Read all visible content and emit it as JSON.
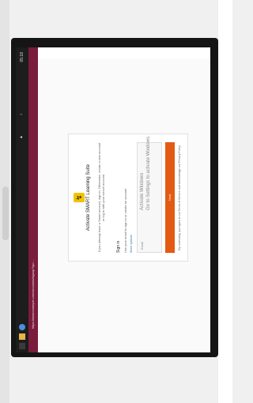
{
  "device": {
    "taskbar": {
      "time": "05:18",
      "tray_text": "ENG"
    },
    "browser": {
      "address_text": "https://www.example.com/accounts/signup?sp=…"
    },
    "page": {
      "heading": "Activate SMART Learning Suite",
      "subheading": "If you already have a Smart account, sign in. Otherwise, create a new account or log in with your school account.",
      "section_title": "Sign in",
      "note": "Use your email to sign in or create an account",
      "link_text": "More options",
      "email_field_text": "Email",
      "primary_button": "Next",
      "footer": "By continuing, you agree to our Terms of Service and acknowledge our Privacy Policy."
    },
    "watermark": {
      "line1": "Activate Windows",
      "line2": "Go to Settings to activate Windows."
    }
  }
}
